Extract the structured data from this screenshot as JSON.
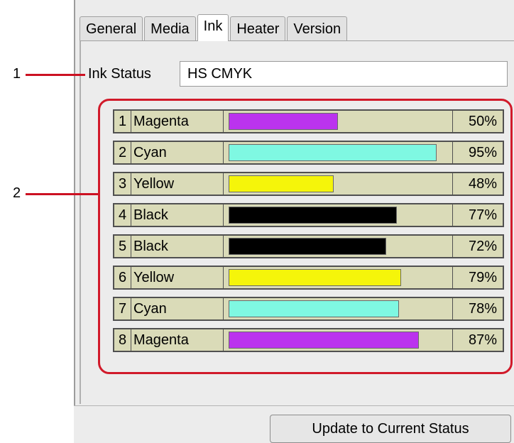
{
  "tabs": [
    {
      "label": "General",
      "active": false
    },
    {
      "label": "Media",
      "active": false
    },
    {
      "label": "Ink",
      "active": true
    },
    {
      "label": "Heater",
      "active": false
    },
    {
      "label": "Version",
      "active": false
    }
  ],
  "callouts": [
    "1",
    "2"
  ],
  "ink_status": {
    "label": "Ink Status",
    "value": "HS CMYK"
  },
  "ink_levels": [
    {
      "slot": "1",
      "name": "Magenta",
      "percent": 50,
      "percent_label": "50%",
      "color": "#bb33ee"
    },
    {
      "slot": "2",
      "name": "Cyan",
      "percent": 95,
      "percent_label": "95%",
      "color": "#7ff8e2"
    },
    {
      "slot": "3",
      "name": "Yellow",
      "percent": 48,
      "percent_label": "48%",
      "color": "#f5f50a"
    },
    {
      "slot": "4",
      "name": "Black",
      "percent": 77,
      "percent_label": "77%",
      "color": "#000000"
    },
    {
      "slot": "5",
      "name": "Black",
      "percent": 72,
      "percent_label": "72%",
      "color": "#000000"
    },
    {
      "slot": "6",
      "name": "Yellow",
      "percent": 79,
      "percent_label": "79%",
      "color": "#f5f50a"
    },
    {
      "slot": "7",
      "name": "Cyan",
      "percent": 78,
      "percent_label": "78%",
      "color": "#7ff8e2"
    },
    {
      "slot": "8",
      "name": "Magenta",
      "percent": 87,
      "percent_label": "87%",
      "color": "#bb33ee"
    }
  ],
  "update_button": {
    "label": "Update to Current Status"
  },
  "colors": {
    "callout_red": "#d11a2a",
    "row_background": "#dadbb8"
  }
}
